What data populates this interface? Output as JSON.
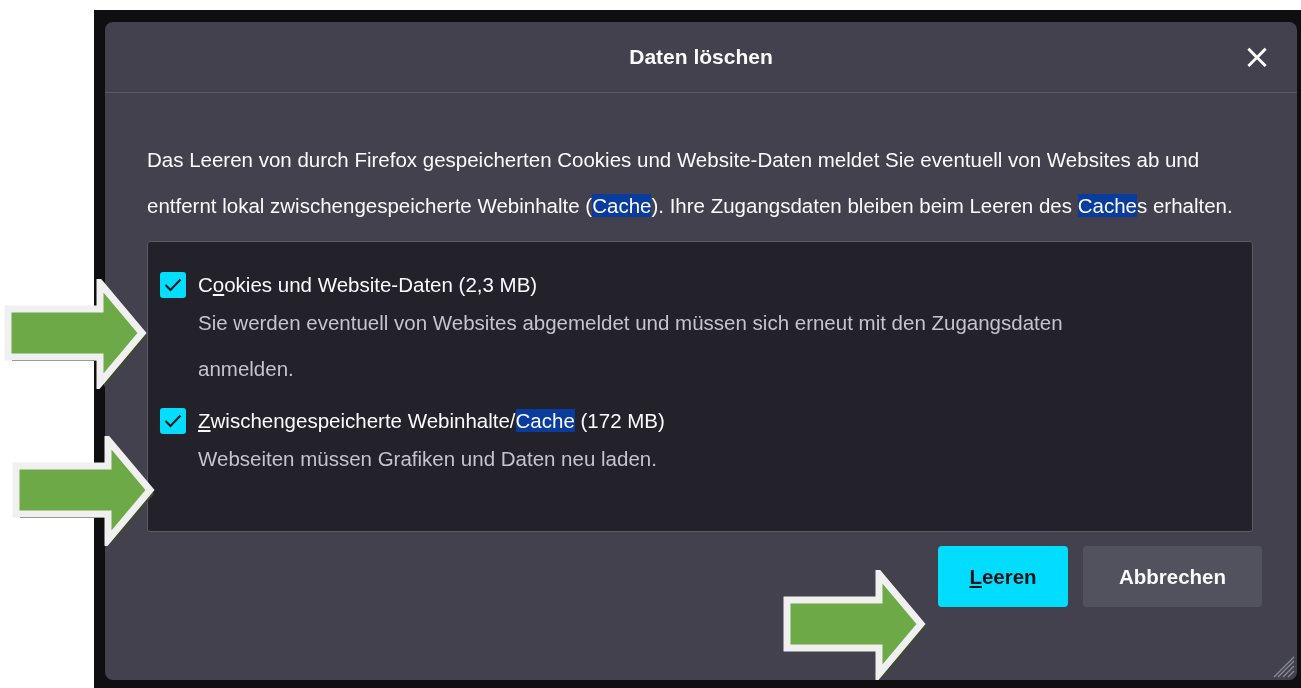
{
  "dialog": {
    "title": "Daten löschen",
    "close_label": "×",
    "intro": [
      {
        "text": "Das Leeren von durch Firefox gespeicherten Cookies und Website-Daten meldet Sie eventuell von Websites ab und entfernt lokal zwischengespeicherte Webinhalte (",
        "kind": "plain"
      },
      {
        "text": "Cache",
        "kind": "highlight"
      },
      {
        "text": "). Ihre Zugangsdaten bleiben beim Leeren des ",
        "kind": "plain"
      },
      {
        "text": "Cache",
        "kind": "highlight"
      },
      {
        "text": "s erhalten.",
        "kind": "plain"
      }
    ],
    "options": [
      {
        "checked": true,
        "label": [
          {
            "text": "C",
            "kind": "plain"
          },
          {
            "text": "o",
            "kind": "accesskey"
          },
          {
            "text": "okies und Website-Daten (2,3 MB)",
            "kind": "plain"
          }
        ],
        "description": "Sie werden eventuell von Websites abgemeldet und müssen sich erneut mit den Zugangsdaten anmelden."
      },
      {
        "checked": true,
        "label": [
          {
            "text": "Z",
            "kind": "accesskey"
          },
          {
            "text": "wischengespeicherte Webinhalte/",
            "kind": "plain"
          },
          {
            "text": "Cache",
            "kind": "highlight"
          },
          {
            "text": " (172 MB)",
            "kind": "plain"
          }
        ],
        "description": "Webseiten müssen Grafiken und Daten neu laden."
      }
    ],
    "buttons": [
      {
        "kind": "primary",
        "label": [
          {
            "text": "L",
            "kind": "accesskey"
          },
          {
            "text": "eeren",
            "kind": "plain"
          }
        ]
      },
      {
        "kind": "secondary",
        "label": [
          {
            "text": "Abbrechen",
            "kind": "plain"
          }
        ]
      }
    ]
  },
  "annotations": [
    {
      "kind": "arrow"
    },
    {
      "kind": "arrow"
    },
    {
      "kind": "arrow"
    }
  ]
}
